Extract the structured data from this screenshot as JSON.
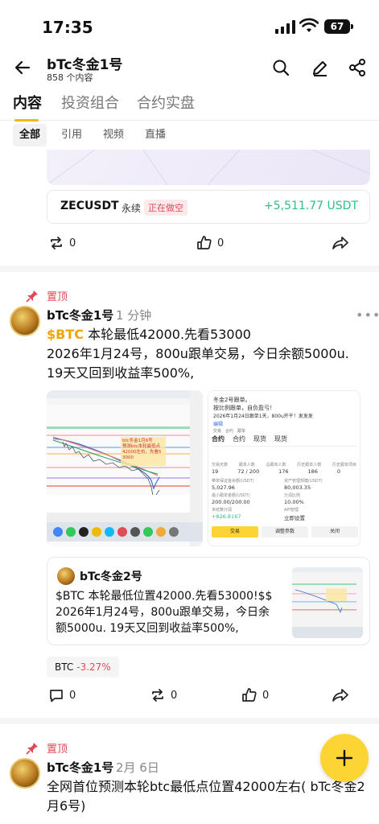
{
  "status": {
    "time": "17:35",
    "battery": "67"
  },
  "header": {
    "title": "bTc冬金1号",
    "subtitle": "858 个内容"
  },
  "tabs": [
    {
      "label": "内容"
    },
    {
      "label": "投资组合"
    },
    {
      "label": "合约实盘"
    }
  ],
  "filters": [
    {
      "label": "全部"
    },
    {
      "label": "引用"
    },
    {
      "label": "视频"
    },
    {
      "label": "直播"
    }
  ],
  "trade": {
    "symbol": "ZECUSDT",
    "type": "永续",
    "status": "正在做空",
    "pnl": "+5,511.77 USDT"
  },
  "post1_actions": {
    "repost": "0",
    "like": "0"
  },
  "post2": {
    "pin": "置顶",
    "author": "bTc冬金1号",
    "time": "1 分钟",
    "ticker": "$BTC",
    "line1": " 本轮最低42000.先看53000",
    "line2": "2026年1月24号，800u跟单交易，今日余额5000u. 19天又回到收益率500%,",
    "image_a": {
      "annotation": "btc冬金1月6号\n预测btc本轮最低点\n42000左右，先看5\n3000"
    },
    "image_b": {
      "header": "冬金2号跟单。",
      "subheader": "按比例跟单，自负盈亏！",
      "note": "2026年1月24日跟单1天，800u开干！发发发",
      "edit": "编辑",
      "tabs": [
        "合约",
        "合约",
        "现货",
        "现货"
      ],
      "sub_tabs": [
        "交易",
        "合约",
        "跟单"
      ],
      "days_label": "交易天数",
      "days": "19",
      "followers_label": "跟单人数",
      "followers": "72 / 200",
      "total_label": "总跟单人数",
      "total": "176",
      "history_label": "历史跟单人数",
      "history": "186",
      "history_proj_label": "历史跟单项目",
      "history_proj": "0",
      "margin_label": "带单保证金余额(USDT)",
      "margin": "5,027.96",
      "aum_label": "资产管理规模(USDT)",
      "aum": "80,003.35",
      "min_label": "最小跟单金额(USDT)",
      "min": "200.00/200.00",
      "share_label": "分润比例",
      "share": "10.00%",
      "pending_label": "未结算分润",
      "pending": "+826.8167",
      "api_label": "API管理",
      "api": "立即设置",
      "btn_trade": "交易",
      "btn_adjust": "调整参数",
      "btn_close": "关闭"
    },
    "quote": {
      "author": "bTc冬金2号",
      "text": "$BTC 本轮最低位置42000.先看53000!$$ 2026年1月24号，800u跟单交易，今日余额5000u. 19天又回到收益率500%,"
    },
    "coin": {
      "symbol": "BTC",
      "change": "-3.27%"
    },
    "actions": {
      "comment": "0",
      "repost": "0",
      "like": "0"
    }
  },
  "post3": {
    "pin": "置顶",
    "author": "bTc冬金1号",
    "time": "2月 6日",
    "text": "全网首位预测本轮btc最低点位置42000左右( bTc冬金2月6号)"
  },
  "colors": {
    "accent": "#f0b90b",
    "fab": "#fcd535",
    "up": "#2ebd85",
    "down": "#e04a56"
  }
}
